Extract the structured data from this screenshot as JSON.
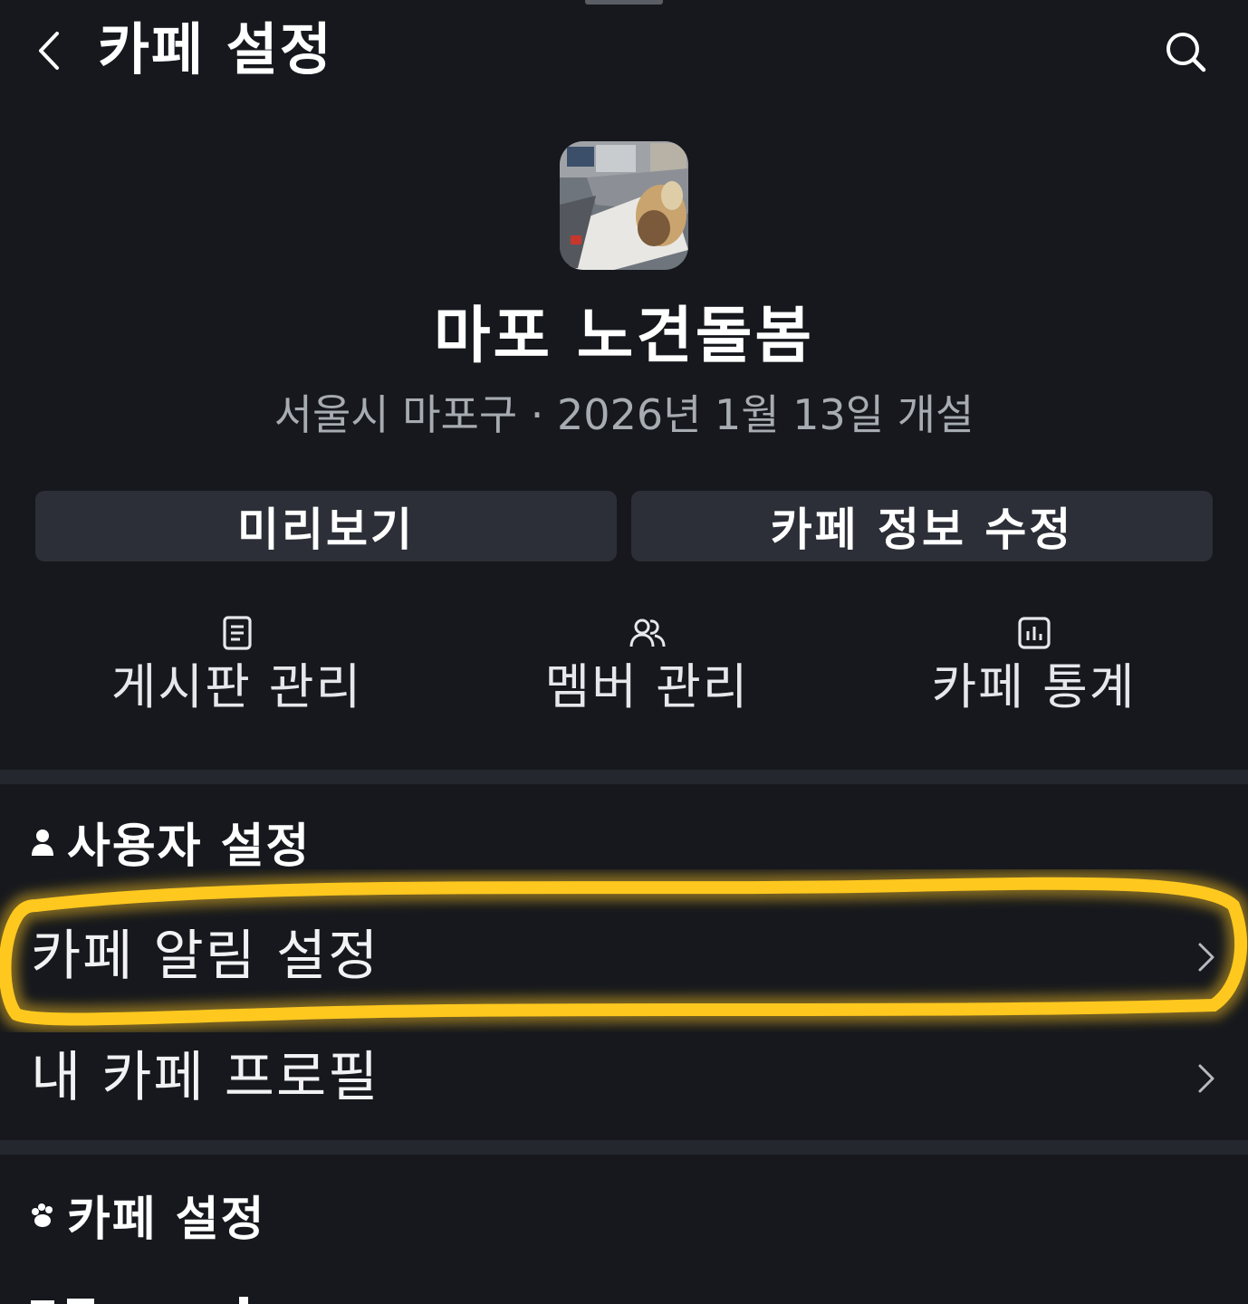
{
  "header": {
    "title": "카페 설정",
    "back_icon": "chevron-left-icon",
    "search_icon": "search-icon"
  },
  "cafe": {
    "name": "마포 노견돌봄",
    "meta": "서울시 마포구 · 2026년 1월 13일 개설"
  },
  "actions": {
    "preview_label": "미리보기",
    "edit_label": "카페 정보 수정"
  },
  "quick_menu": [
    {
      "label": "게시판 관리",
      "icon": "document-icon"
    },
    {
      "label": "멤버 관리",
      "icon": "members-icon"
    },
    {
      "label": "카페 통계",
      "icon": "chart-icon"
    }
  ],
  "user_settings": {
    "title": "사용자 설정",
    "items": [
      {
        "label": "카페 알림 설정"
      },
      {
        "label": "내 카페 프로필"
      }
    ]
  },
  "cafe_settings": {
    "title": "카페 설정"
  },
  "colors": {
    "background": "#16181d",
    "button_bg": "#2c2f37",
    "divider": "#24272e",
    "highlight": "#ffc81e"
  }
}
